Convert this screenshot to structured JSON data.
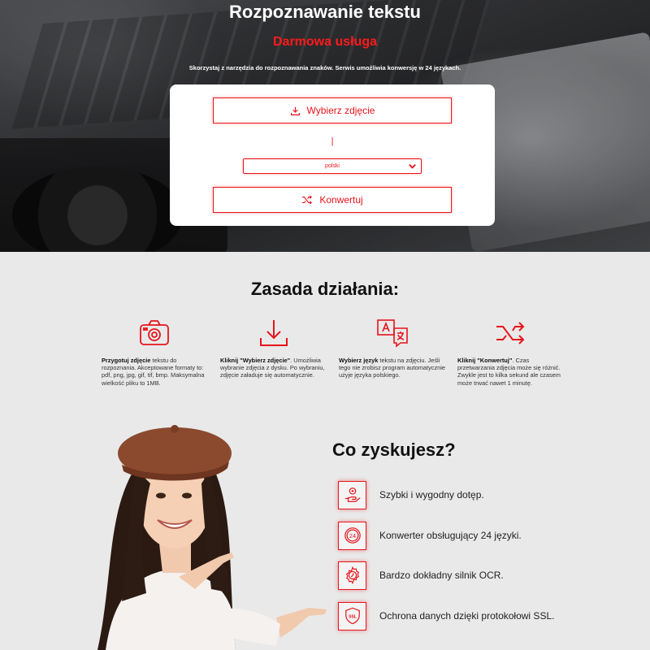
{
  "hero": {
    "title": "Rozpoznawanie tekstu",
    "subtitle": "Darmowa usługa",
    "description": "Skorzystaj z narzędzia do rozpoznawania znaków. Serwis umożliwia konwersję w 24 językach."
  },
  "form": {
    "upload_label": "Wybierz zdjęcie",
    "file_indicator": "|",
    "language_selected": "polski",
    "convert_label": "Konwertuj"
  },
  "how": {
    "title": "Zasada działania:",
    "steps": [
      {
        "icon": "camera-icon",
        "bold": "Przygotuj zdjęcie",
        "text": " tekstu do rozpoznania. Akceptowane formaty to: pdf, png, jpg, gif, tif, bmp. Maksymalna wielkość pliku to 1MB."
      },
      {
        "icon": "download-icon",
        "bold": "Kliknij \"Wybierz zdjęcie\"",
        "text": ". Umożliwia wybranie zdjęcia z dysku. Po wybraniu, zdjęcie załaduje się automatycznie."
      },
      {
        "icon": "translate-icon",
        "bold": "Wybierz język",
        "text": " tekstu na zdjęciu. Jeśli tego nie zrobisz program automatycznie użyje języka polskiego."
      },
      {
        "icon": "shuffle-icon",
        "bold": "Kliknij \"Konwertuj\"",
        "text": ". Czas przetwarzania zdjęcia może się różnić. Zwykle jest to kilka sekund ale czasem może trwać nawet 1 minutę."
      }
    ]
  },
  "benefits": {
    "title": "Co zyskujesz?",
    "items": [
      {
        "icon": "hand-coin-icon",
        "text": "Szybki i wygodny dotęp."
      },
      {
        "icon": "24-hours-icon",
        "text": "Konwerter obsługujący 24 języki."
      },
      {
        "icon": "gear-icon",
        "text": "Bardzo dokładny silnik OCR."
      },
      {
        "icon": "ssl-shield-icon",
        "text": "Ochrona danych dzięki protokołowi SSL."
      }
    ]
  },
  "colors": {
    "accent": "#e8141b",
    "page_bg": "#e9e9e9",
    "text": "#111111"
  }
}
